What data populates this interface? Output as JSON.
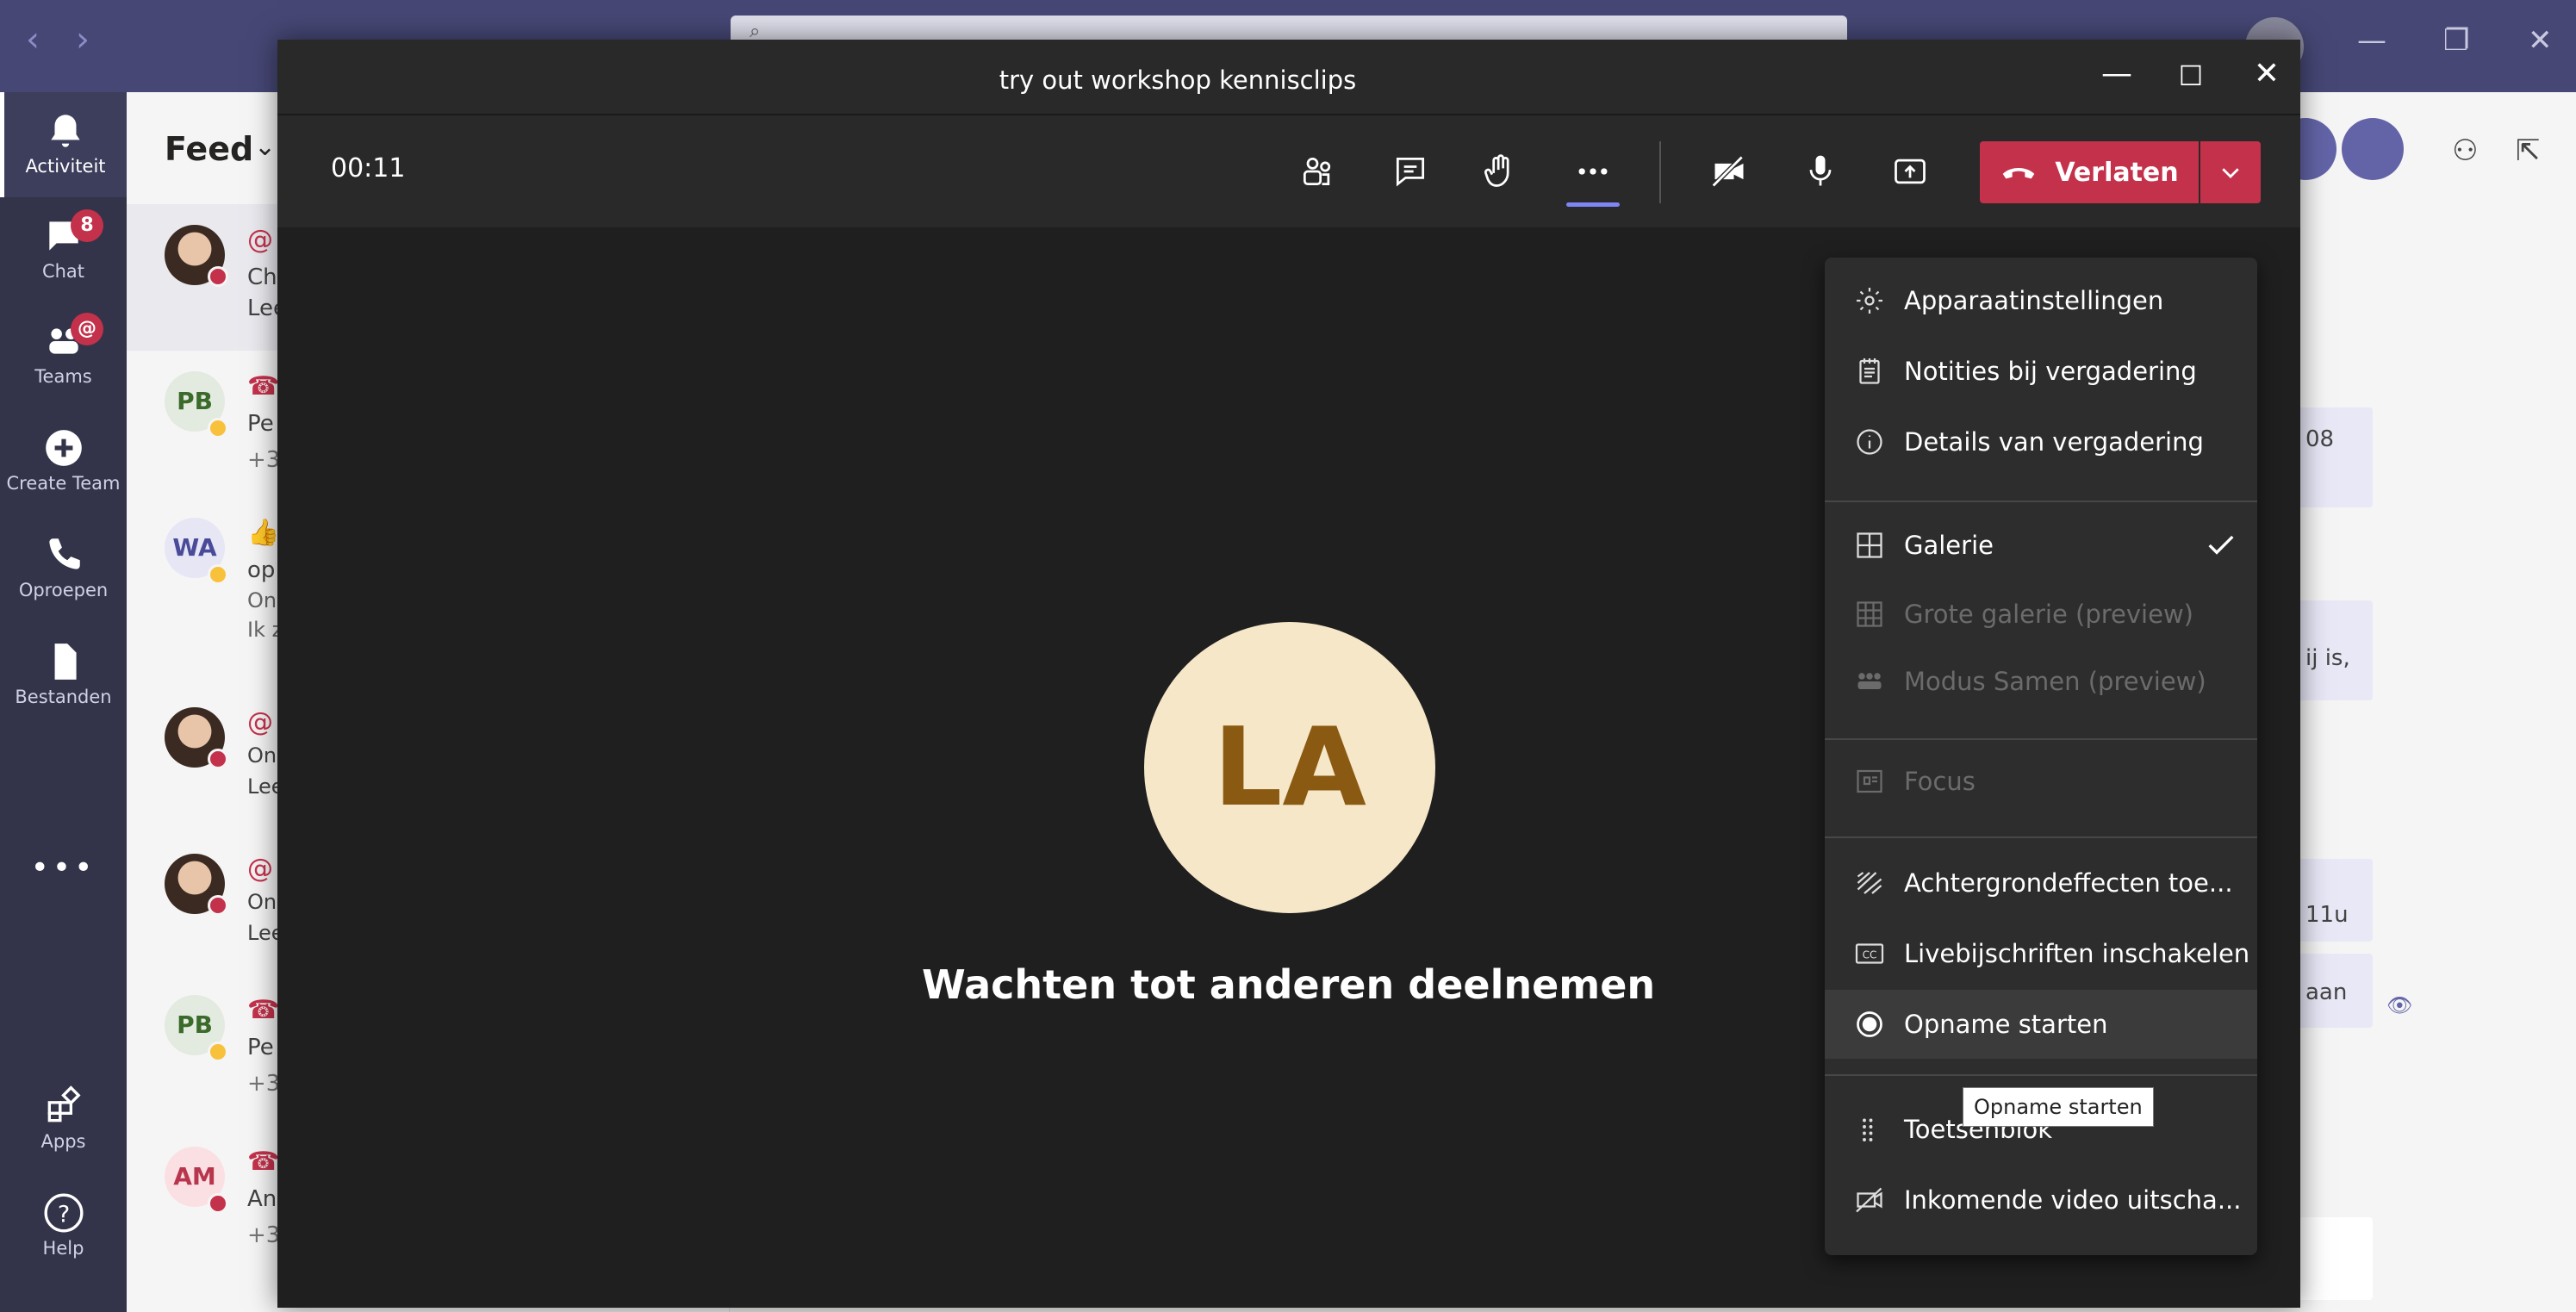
{
  "app": {
    "rail": [
      {
        "label": "Activiteit"
      },
      {
        "label": "Chat",
        "badge": "8"
      },
      {
        "label": "Teams",
        "badge": "@"
      },
      {
        "label": "Create Team"
      },
      {
        "label": "Oproepen"
      },
      {
        "label": "Bestanden"
      },
      {
        "label": "Apps"
      },
      {
        "label": "Help"
      }
    ],
    "rail_more": "•••",
    "feed": {
      "title": "Feed",
      "rows": [
        {
          "initials": "",
          "line1": "Cha",
          "line2": "Lee"
        },
        {
          "initials": "PB",
          "line1": "Pe",
          "line2": "+3"
        },
        {
          "initials": "WA",
          "line1": "op",
          "line2": "On",
          "line3": "Ik z"
        },
        {
          "initials": "",
          "line1": "On",
          "line2": "Lee"
        },
        {
          "initials": "",
          "line1": "On",
          "line2": "Lee"
        },
        {
          "initials": "PB",
          "line1": "Pe",
          "line2": "+3"
        },
        {
          "initials": "AM",
          "line1": "An",
          "line2": "+3"
        }
      ]
    },
    "right_pane": {
      "card_texts": [
        "08",
        "ij is,",
        "11u",
        "aan"
      ]
    }
  },
  "meeting": {
    "window_title": "try out workshop kennisclips",
    "timer": "00:11",
    "leave_label": "Verlaten",
    "participant_initials": "LA",
    "waiting_text": "Wachten tot anderen deelnemen",
    "colors": {
      "leave": "#c4314b",
      "accent": "#7f85f5",
      "avatar_bg": "#f6e7c8"
    }
  },
  "menu": {
    "items": [
      {
        "label": "Apparaatinstellingen",
        "icon": "gear-icon"
      },
      {
        "label": "Notities bij vergadering",
        "icon": "notes-icon"
      },
      {
        "label": "Details van vergadering",
        "icon": "info-icon"
      },
      {
        "label": "Galerie",
        "icon": "gallery-icon",
        "checked": true
      },
      {
        "label": "Grote galerie (preview)",
        "icon": "large-gallery-icon",
        "disabled": true
      },
      {
        "label": "Modus Samen (preview)",
        "icon": "together-mode-icon",
        "disabled": true
      },
      {
        "label": "Focus",
        "icon": "focus-icon",
        "disabled": true
      },
      {
        "label": "Achtergrondeffecten toe...",
        "icon": "background-effects-icon"
      },
      {
        "label": "Livebijschriften inschakelen",
        "icon": "captions-icon"
      },
      {
        "label": "Opname starten",
        "icon": "record-icon",
        "hovered": true
      },
      {
        "label": "Toetsenblok",
        "icon": "dialpad-icon"
      },
      {
        "label": "Inkomende video uitscha...",
        "icon": "video-off-icon"
      }
    ],
    "tooltip": "Opname starten"
  }
}
